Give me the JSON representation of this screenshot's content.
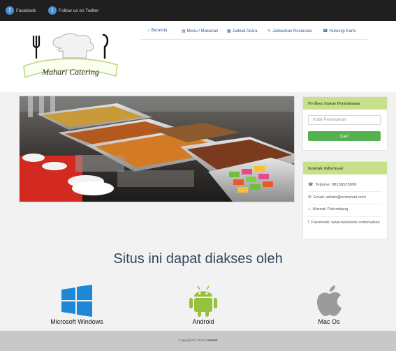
{
  "topbar": {
    "facebook_label": "Facebook",
    "twitter_label": "Follow us on Twitter"
  },
  "logo": {
    "text": "Mahari Catering"
  },
  "nav": {
    "items": [
      {
        "icon": "home-icon",
        "glyph": "⌂",
        "label": "Beranda"
      },
      {
        "icon": "book-icon",
        "glyph": "▤",
        "label": "Menu / Makanan"
      },
      {
        "icon": "calendar-icon",
        "glyph": "▦",
        "label": "Jadwal Acara"
      },
      {
        "icon": "pencil-icon",
        "glyph": "✎",
        "label": "Jadwalkan Reservasi"
      },
      {
        "icon": "phone-icon",
        "glyph": "☎",
        "label": "Hubungi Kami"
      }
    ]
  },
  "status_panel": {
    "title": "Periksa Status Permintaan",
    "input_placeholder": "Kode Pemesanan",
    "button_label": "Cari"
  },
  "contact_panel": {
    "title": "Kontak Informasi",
    "items": [
      {
        "icon": "phone-icon",
        "glyph": "☎",
        "text": "Telpone: 08136525998"
      },
      {
        "icon": "email-icon",
        "glyph": "✉",
        "text": "Email: admin@ormahari.com"
      },
      {
        "icon": "home-icon",
        "glyph": "⌂",
        "text": "Alamat: Palembang"
      },
      {
        "icon": "facebook-icon",
        "glyph": "f",
        "text": "Facebook: www.facebook.com/mahari"
      }
    ]
  },
  "access": {
    "heading": "Situs ini dapat diakses oleh",
    "platforms": [
      {
        "name": "Microsoft Windows",
        "icon": "windows-icon"
      },
      {
        "name": "Android",
        "icon": "android-icon"
      },
      {
        "name": "Mac Os",
        "icon": "apple-icon"
      }
    ]
  },
  "footer": {
    "prefix": "Copyright © 2018 |",
    "name": "Genial"
  },
  "colors": {
    "topbar": "#1f1f1f",
    "panel_header": "#c7e089",
    "button": "#55b04f",
    "windows": "#1e88d8",
    "android": "#94c23a",
    "apple": "#9b9b9b",
    "footer": "#c8c8c8"
  }
}
